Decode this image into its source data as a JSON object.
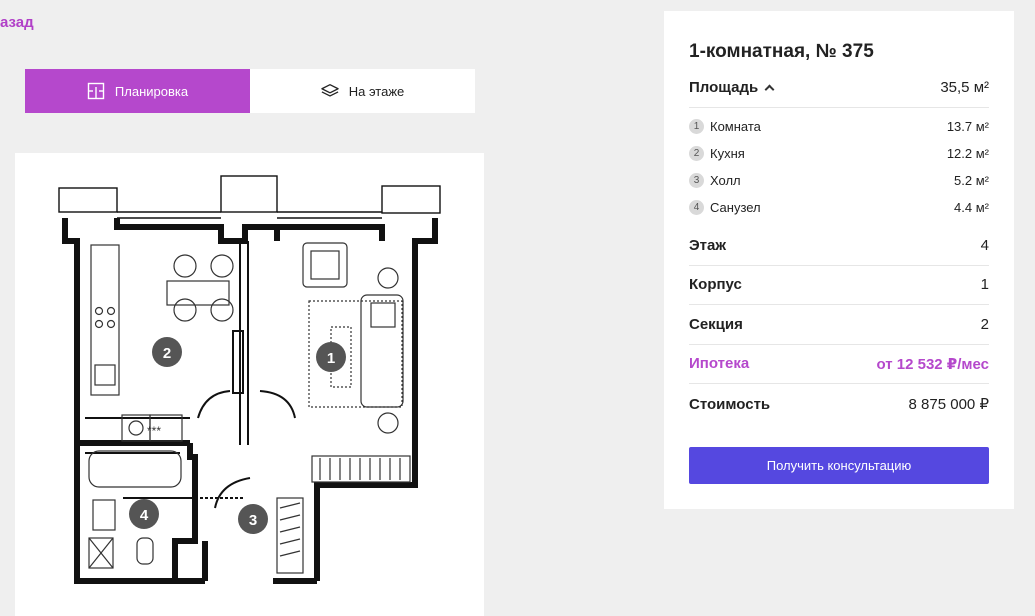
{
  "nav": {
    "back_label": "азад"
  },
  "tabs": [
    {
      "label": "Планировка",
      "icon": "floorplan-icon",
      "active": true
    },
    {
      "label": "На этаже",
      "icon": "layers-icon",
      "active": false
    }
  ],
  "plan": {
    "room_numbers": [
      "1",
      "2",
      "3",
      "4"
    ],
    "appliance_label": "***"
  },
  "info": {
    "title": "1-комнатная, № 375",
    "area": {
      "label": "Площадь",
      "value": "35,5 м²"
    },
    "rooms": [
      {
        "num": "1",
        "name": "Комната",
        "area": "13.7 м²"
      },
      {
        "num": "2",
        "name": "Кухня",
        "area": "12.2 м²"
      },
      {
        "num": "3",
        "name": "Холл",
        "area": "5.2 м²"
      },
      {
        "num": "4",
        "name": "Санузел",
        "area": "4.4 м²"
      }
    ],
    "floor": {
      "label": "Этаж",
      "value": "4"
    },
    "building": {
      "label": "Корпус",
      "value": "1"
    },
    "section": {
      "label": "Секция",
      "value": "2"
    },
    "mortgage": {
      "label": "Ипотека",
      "value": "от 12 532 ₽/мес"
    },
    "price": {
      "label": "Стоимость",
      "value": "8 875 000 ₽"
    },
    "cta_label": "Получить консультацию"
  },
  "colors": {
    "accent": "#b548cc",
    "button": "#5548e0",
    "background": "#efefef"
  }
}
